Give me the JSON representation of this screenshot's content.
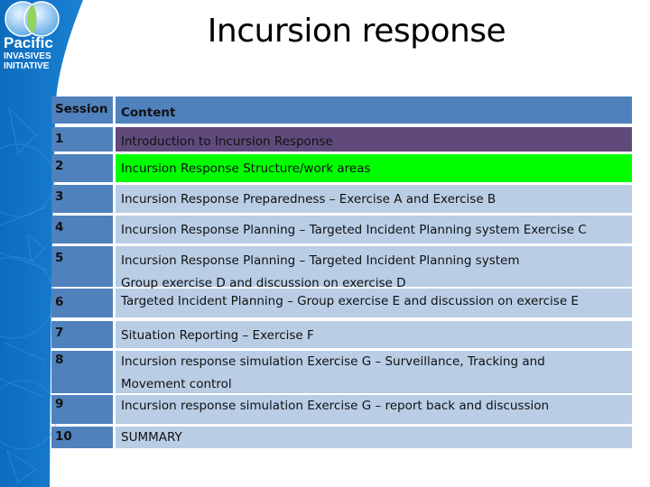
{
  "slide": {
    "title": "Incursion response"
  },
  "logo": {
    "line1": "Pacific",
    "line2": "INVASIVES",
    "line3": "INITIATIVE"
  },
  "colors": {
    "header_bg": "#4f81bd",
    "row_bg": "#b9cde5",
    "row1_highlight": "#604a7b",
    "row2_highlight": "#00ff00",
    "side_panel": "#1273c4"
  },
  "table": {
    "headers": [
      "Session",
      "Content"
    ],
    "rows": [
      {
        "session": "1",
        "lines": [
          "Introduction to Incursion Response"
        ]
      },
      {
        "session": "2",
        "lines": [
          "Incursion Response Structure/work areas"
        ]
      },
      {
        "session": "3",
        "lines": [
          "Incursion Response Preparedness – Exercise A and Exercise B"
        ]
      },
      {
        "session": "4",
        "lines": [
          "Incursion Response Planning – Targeted Incident Planning system Exercise C"
        ]
      },
      {
        "session": "5",
        "lines": [
          "Incursion Response Planning – Targeted Incident Planning system",
          "Group exercise D and discussion on exercise D"
        ]
      },
      {
        "session": "6",
        "lines": [
          "Targeted Incident Planning – Group exercise E and discussion on exercise E"
        ]
      },
      {
        "session": "7",
        "lines": [
          "Situation Reporting – Exercise F"
        ]
      },
      {
        "session": "8",
        "lines": [
          "Incursion response simulation Exercise G – Surveillance, Tracking and",
          "Movement control"
        ]
      },
      {
        "session": "9",
        "lines": [
          "Incursion response simulation Exercise G – report back and discussion"
        ]
      },
      {
        "session": "10",
        "lines": [
          "SUMMARY"
        ]
      }
    ]
  }
}
